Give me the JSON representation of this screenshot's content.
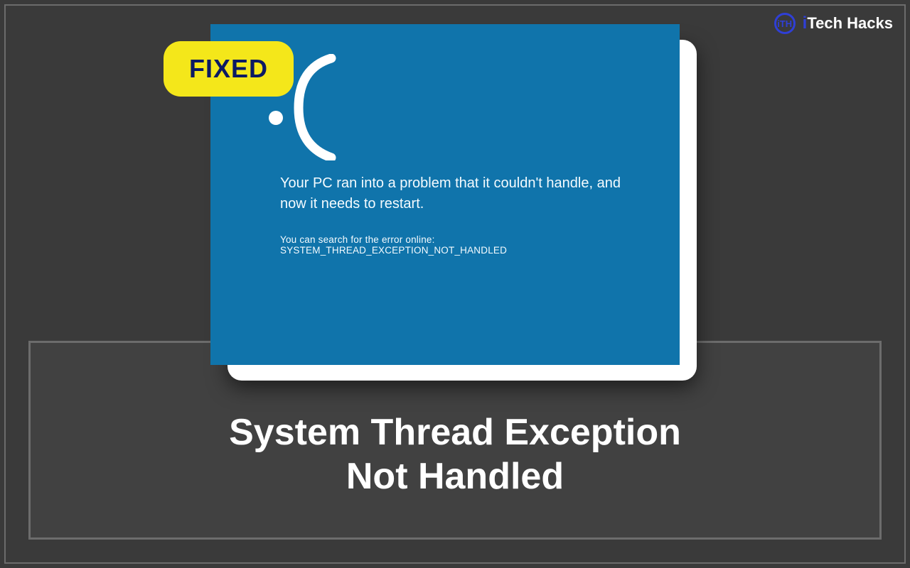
{
  "brand": {
    "logo_text": "iTH",
    "name_prefix": "i",
    "name_rest": "Tech Hacks"
  },
  "badge": {
    "label": "FIXED"
  },
  "bsod": {
    "main_text": "Your PC ran into a problem that it couldn't handle, and now it needs to restart.",
    "search_text": "You can search for the error online: SYSTEM_THREAD_EXCEPTION_NOT_HANDLED"
  },
  "title": {
    "line1": "System Thread Exception",
    "line2": "Not Handled"
  },
  "colors": {
    "bg": "#3a3a3a",
    "panel": "#414141",
    "border": "#6c6c6c",
    "bsod_blue": "#1074ab",
    "badge_yellow": "#f4e71a",
    "badge_text": "#0c1a63",
    "brand_blue": "#2f3fd6"
  }
}
